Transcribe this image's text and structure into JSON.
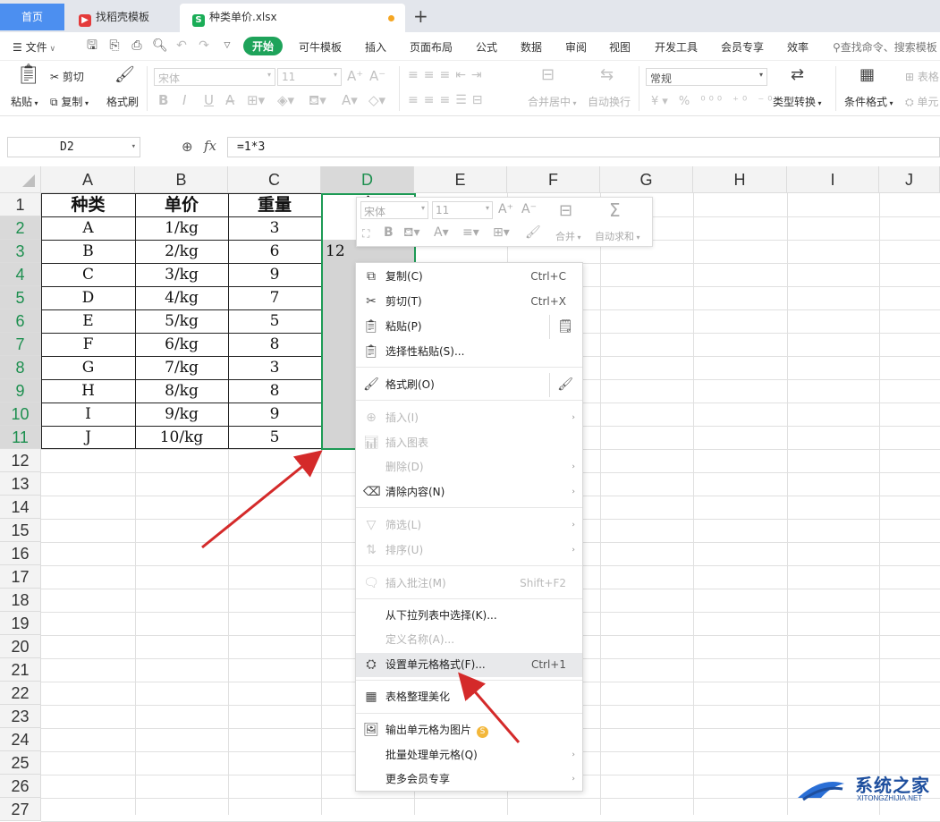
{
  "tabs": {
    "home": "首页",
    "doc1": "找稻壳模板",
    "doc2": "种类单价.xlsx",
    "add": "+"
  },
  "menu": {
    "file": "文件",
    "items": [
      "开始",
      "可牛模板",
      "插入",
      "页面布局",
      "公式",
      "数据",
      "审阅",
      "视图",
      "开发工具",
      "会员专享",
      "效率"
    ],
    "search": "查找命令、搜索模板"
  },
  "ribbon": {
    "paste": "粘贴",
    "cut": "剪切",
    "copy": "复制",
    "format_painter": "格式刷",
    "font_name": "宋体",
    "font_size": "11",
    "merge_center": "合并居中",
    "wrap": "自动换行",
    "number_format": "常规",
    "type_convert": "类型转换",
    "cond_format": "条件格式",
    "table_style": "表格",
    "cell_style": "单元"
  },
  "formula_bar": {
    "name_box": "D2",
    "fx": "fx",
    "formula": "=1*3"
  },
  "grid": {
    "columns": [
      "A",
      "B",
      "C",
      "D",
      "E",
      "F",
      "G",
      "H",
      "I",
      "J"
    ],
    "rows": [
      "1",
      "2",
      "3",
      "4",
      "5",
      "6",
      "7",
      "8",
      "9",
      "10",
      "11",
      "12",
      "13",
      "14",
      "15",
      "16",
      "17",
      "18",
      "19",
      "20",
      "21",
      "22",
      "23",
      "24",
      "25",
      "26",
      "27"
    ],
    "header": [
      "种类",
      "单价",
      "重量",
      "合"
    ],
    "data": [
      [
        "A",
        "1/kg",
        "3"
      ],
      [
        "B",
        "2/kg",
        "6"
      ],
      [
        "C",
        "3/kg",
        "9"
      ],
      [
        "D",
        "4/kg",
        "7"
      ],
      [
        "E",
        "5/kg",
        "5"
      ],
      [
        "F",
        "6/kg",
        "8"
      ],
      [
        "G",
        "7/kg",
        "3"
      ],
      [
        "H",
        "8/kg",
        "8"
      ],
      [
        "I",
        "9/kg",
        "9"
      ],
      [
        "J",
        "10/kg",
        "5"
      ]
    ],
    "d3_value": "12"
  },
  "mini_toolbar": {
    "font_name": "宋体",
    "font_size": "11",
    "merge": "合并",
    "autosum": "自动求和"
  },
  "context_menu": {
    "copy": "复制(C)",
    "copy_sc": "Ctrl+C",
    "cut": "剪切(T)",
    "cut_sc": "Ctrl+X",
    "paste": "粘贴(P)",
    "paste_special": "选择性粘贴(S)...",
    "format_painter": "格式刷(O)",
    "insert": "插入(I)",
    "insert_chart": "插入图表",
    "delete": "删除(D)",
    "clear": "清除内容(N)",
    "filter": "筛选(L)",
    "sort": "排序(U)",
    "insert_comment": "插入批注(M)",
    "insert_comment_sc": "Shift+F2",
    "pick_list": "从下拉列表中选择(K)...",
    "define_name": "定义名称(A)...",
    "format_cells": "设置单元格格式(F)...",
    "format_cells_sc": "Ctrl+1",
    "beautify": "表格整理美化",
    "export_image": "输出单元格为图片",
    "batch": "批量处理单元格(Q)",
    "more_vip": "更多会员专享"
  },
  "watermark": {
    "title": "系统之家",
    "url": "XITONGZHIJIA.NET"
  },
  "colors": {
    "accent_green": "#1d9a55",
    "tab_blue": "#4c8ff0",
    "arrow_red": "#d42a2a"
  }
}
